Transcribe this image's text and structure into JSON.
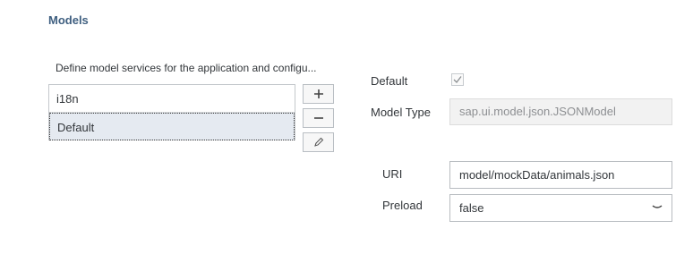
{
  "section": {
    "title": "Models"
  },
  "models": {
    "description": "Define model services for the application and configu...",
    "items": [
      {
        "label": "i18n",
        "selected": false
      },
      {
        "label": "Default",
        "selected": true
      }
    ],
    "buttons": {
      "add": "add-icon",
      "remove": "remove-icon",
      "edit": "edit-icon"
    }
  },
  "details": {
    "default_label": "Default",
    "default_checked": true,
    "model_type_label": "Model Type",
    "model_type_value": "sap.ui.model.json.JSONModel",
    "uri_label": "URI",
    "uri_value": "model/mockData/animals.json",
    "preload_label": "Preload",
    "preload_value": "false"
  },
  "colors": {
    "title": "#3f5f80",
    "selected_bg": "#e5eaf1"
  }
}
